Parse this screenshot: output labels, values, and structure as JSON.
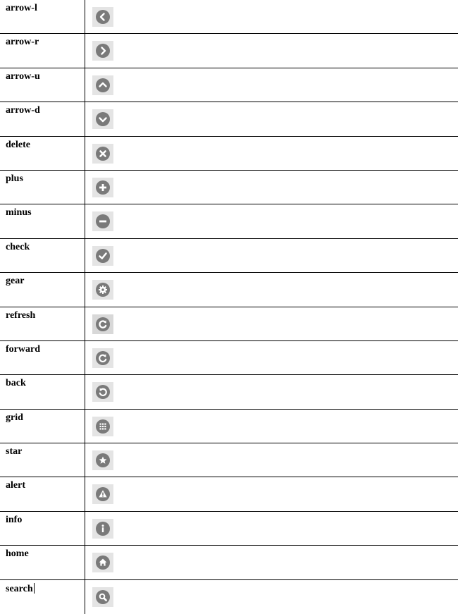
{
  "rows": [
    {
      "name": "arrow-l",
      "icon": "arrow-left-icon"
    },
    {
      "name": "arrow-r",
      "icon": "arrow-right-icon"
    },
    {
      "name": "arrow-u",
      "icon": "arrow-up-icon"
    },
    {
      "name": "arrow-d",
      "icon": "arrow-down-icon"
    },
    {
      "name": "delete",
      "icon": "delete-icon"
    },
    {
      "name": "plus",
      "icon": "plus-icon"
    },
    {
      "name": "minus",
      "icon": "minus-icon"
    },
    {
      "name": "check",
      "icon": "check-icon"
    },
    {
      "name": "gear",
      "icon": "gear-icon"
    },
    {
      "name": "refresh",
      "icon": "refresh-icon"
    },
    {
      "name": "forward",
      "icon": "forward-icon"
    },
    {
      "name": "back",
      "icon": "back-icon"
    },
    {
      "name": "grid",
      "icon": "grid-icon"
    },
    {
      "name": "star",
      "icon": "star-icon"
    },
    {
      "name": "alert",
      "icon": "alert-icon"
    },
    {
      "name": "info",
      "icon": "info-icon"
    },
    {
      "name": "home",
      "icon": "home-icon"
    },
    {
      "name": "search",
      "icon": "search-icon"
    }
  ],
  "colors": {
    "icon_circle": "#7a7a7a",
    "tile": "#e4e4e4",
    "rule": "#000000"
  }
}
